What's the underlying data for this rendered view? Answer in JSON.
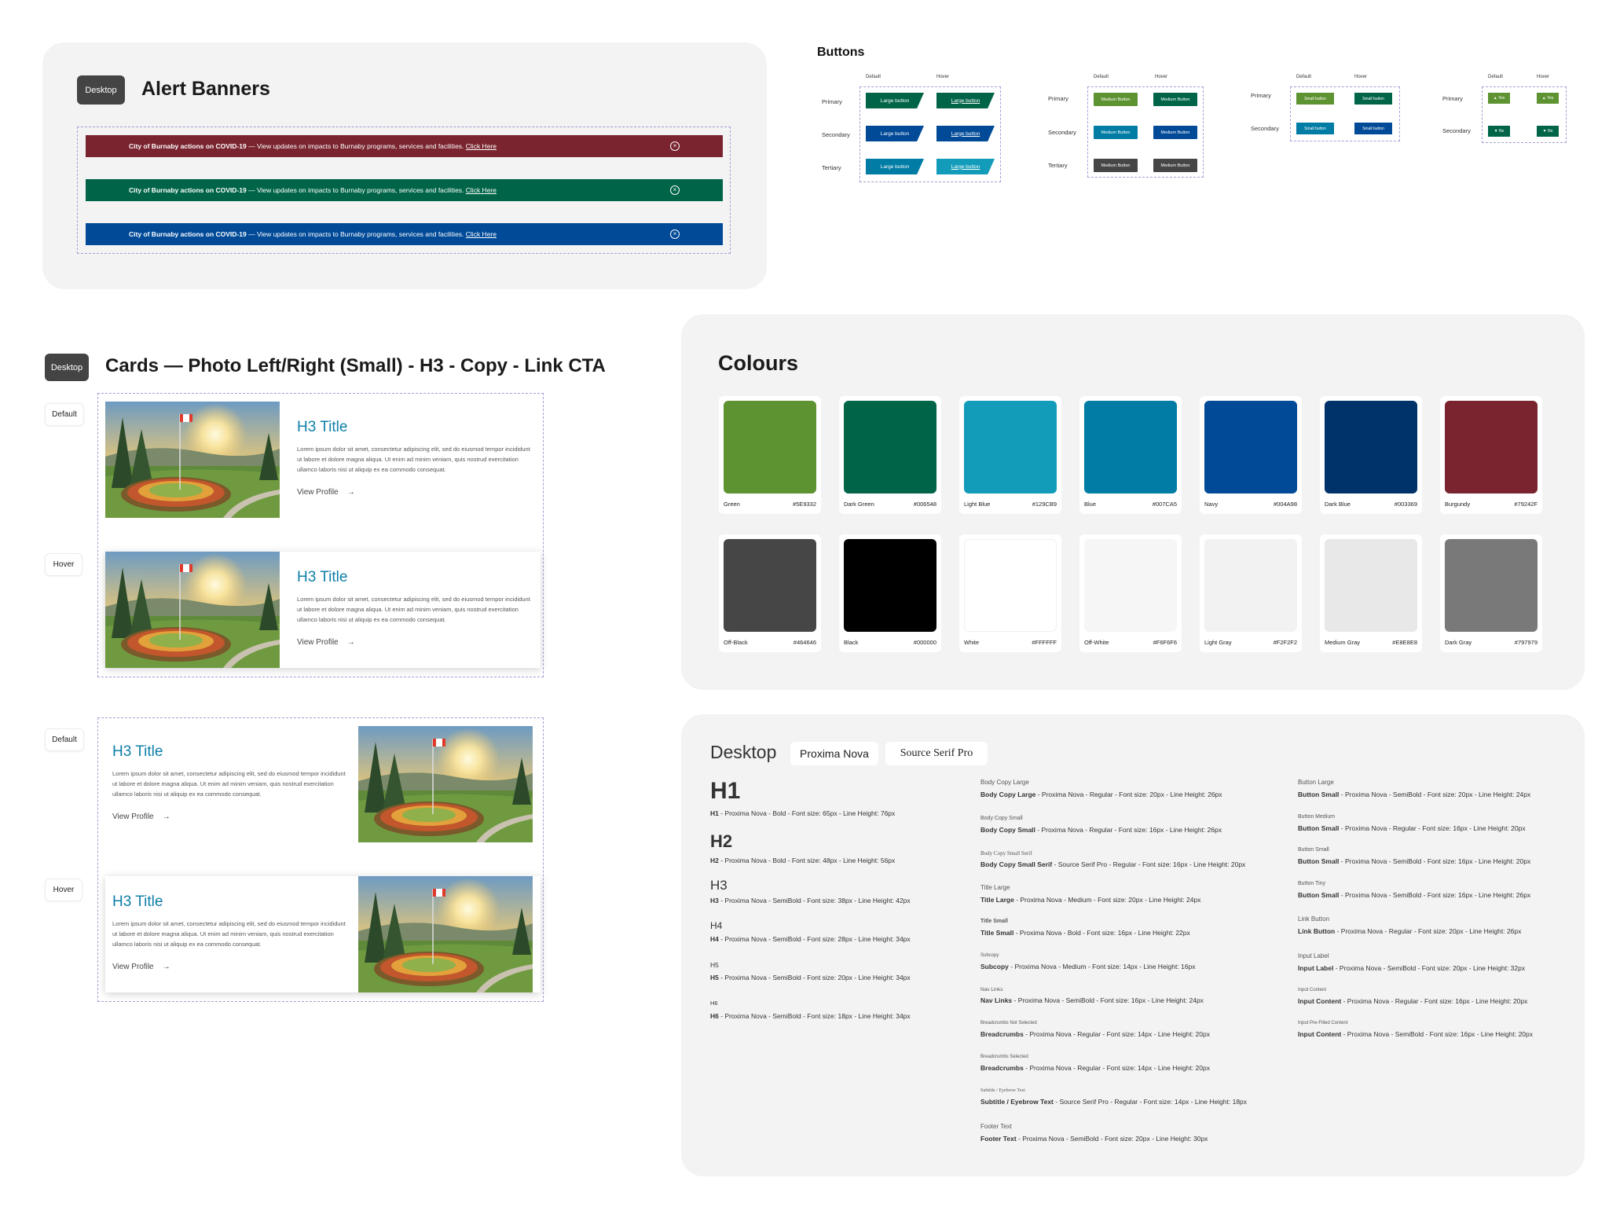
{
  "alerts": {
    "tag": "Desktop",
    "title": "Alert Banners",
    "banners": [
      {
        "bold": "City of Burnaby actions on COVID-19",
        "text": " — View updates on impacts to Burnaby programs, services and facilities. ",
        "link": "Click Here",
        "color": "#79242F"
      },
      {
        "bold": "City of Burnaby actions on COVID-19",
        "text": " — View updates on impacts to Burnaby programs, services and facilities. ",
        "link": "Click Here",
        "color": "#006548"
      },
      {
        "bold": "City of Burnaby actions on COVID-19",
        "text": " — View updates on impacts to Burnaby programs, services and facilities. ",
        "link": "Click Here",
        "color": "#004A98"
      }
    ]
  },
  "buttons": {
    "title": "Buttons",
    "default_label": "Default",
    "hover_label": "Hover",
    "row_primary": "Primary",
    "row_secondary": "Secondary",
    "row_tertiary": "Tertiary",
    "large_label": "Large button",
    "medium_label": "Medium Button",
    "small_label": "Small button",
    "yes_label": "Yes",
    "no_label": "No"
  },
  "cards": {
    "tag": "Desktop",
    "title": "Cards — Photo Left/Right (Small) - H3 - Copy - Link CTA",
    "state_default": "Default",
    "state_hover": "Hover",
    "card_title": "H3 Title",
    "card_copy": "Lorem ipsum dolor sit amet, consectetur adipiscing elit, sed do eiusmod tempor incididunt ut labore et dolore magna aliqua. Ut enim ad minim veniam, quis nostrud exercitation ullamco laboris nisi ut aliquip ex ea commodo consequat.",
    "card_link": "View Profile",
    "arrow": "→"
  },
  "colours": {
    "title": "Colours",
    "swatches": [
      {
        "name": "Green",
        "hex": "#5E9332"
      },
      {
        "name": "Dark Green",
        "hex": "#006548"
      },
      {
        "name": "Light Blue",
        "hex": "#129CB9"
      },
      {
        "name": "Blue",
        "hex": "#007CA5"
      },
      {
        "name": "Navy",
        "hex": "#004A98"
      },
      {
        "name": "Dark Blue",
        "hex": "#003369"
      },
      {
        "name": "Burgundy",
        "hex": "#79242F"
      },
      {
        "name": "Off-Black",
        "hex": "#464646"
      },
      {
        "name": "Black",
        "hex": "#000000"
      },
      {
        "name": "White",
        "hex": "#FFFFFF"
      },
      {
        "name": "Off-White",
        "hex": "#F6F6F6"
      },
      {
        "name": "Light Gray",
        "hex": "#F2F2F2"
      },
      {
        "name": "Medium Gray",
        "hex": "#E8E8E8"
      },
      {
        "name": "Dark Gray",
        "hex": "#797979"
      }
    ]
  },
  "typography": {
    "title": "Desktop",
    "font1": "Proxima Nova",
    "font2": "Source Serif Pro",
    "headings": [
      {
        "sample": "H1",
        "name": "H1",
        "spec": " - Proxima Nova - Bold - Font size: 65px - Line Height: 76px"
      },
      {
        "sample": "H2",
        "name": "H2",
        "spec": " - Proxima Nova - Bold - Font size: 48px - Line Height: 56px"
      },
      {
        "sample": "H3",
        "name": "H3",
        "spec": " - Proxima Nova - SemiBold - Font size: 38px - Line Height: 42px"
      },
      {
        "sample": "H4",
        "name": "H4",
        "spec": " - Proxima Nova - SemiBold - Font size: 28px - Line Height: 34px"
      },
      {
        "sample": "H5",
        "name": "H5",
        "spec": " - Proxima Nova - SemiBold - Font size: 20px - Line Height: 34px"
      },
      {
        "sample": "H6",
        "name": "H6",
        "spec": " - Proxima Nova - SemiBold - Font size: 18px - Line Height: 34px"
      }
    ],
    "body": [
      {
        "cap": "Body Copy Large",
        "name": "Body Copy Large",
        "spec": " - Proxima Nova - Regular - Font size: 20px - Line Height: 26px"
      },
      {
        "cap": "Body Copy Small",
        "name": "Body Copy Small",
        "spec": " - Proxima Nova - Regular - Font size: 16px - Line Height: 26px"
      },
      {
        "cap": "Body Copy Small Serif",
        "name": "Body Copy Small Serif",
        "spec": " - Source Serif Pro - Regular - Font size: 16px - Line Height: 20px"
      },
      {
        "cap": "Title Large",
        "name": "Title Large",
        "spec": " - Proxima Nova - Medium - Font size: 20px - Line Height: 24px"
      },
      {
        "cap": "Title Small",
        "name": "Title Small",
        "spec": " - Proxima Nova - Bold - Font size: 16px - Line Height: 22px"
      },
      {
        "cap": "Subcopy",
        "name": "Subcopy",
        "spec": " - Proxima Nova - Medium - Font size: 14px - Line Height: 16px"
      },
      {
        "cap": "Nav Links",
        "name": "Nav Links",
        "spec": " - Proxima Nova - SemiBold - Font size: 16px - Line Height: 24px"
      },
      {
        "cap": "Breadcrumbs Not Selected",
        "name": "Breadcrumbs",
        "spec": " - Proxima Nova - Regular - Font size: 14px - Line Height: 20px"
      },
      {
        "cap": "Breadcrumbs Selected",
        "name": "Breadcrumbs",
        "spec": " - Proxima Nova - Regular - Font size: 14px - Line Height: 20px"
      },
      {
        "cap": "Subtitle / Eyebrow Text",
        "name": "Subtitle / Eyebrow Text",
        "spec": " - Source Serif Pro - Regular - Font size: 14px - Line Height: 18px"
      },
      {
        "cap": "Footer Text",
        "name": "Footer Text",
        "spec": " - Proxima Nova - SemiBold - Font size: 20px - Line Height: 30px"
      }
    ],
    "ui": [
      {
        "cap": "Button Large",
        "name": "Button Small",
        "spec": " - Proxima Nova - SemiBold - Font size: 20px - Line Height: 24px"
      },
      {
        "cap": "Button Medium",
        "name": "Button Small",
        "spec": " - Proxima Nova - Regular - Font size: 16px - Line Height: 20px"
      },
      {
        "cap": "Button Small",
        "name": "Button Small",
        "spec": " - Proxima Nova - SemiBold - Font size: 16px - Line Height: 20px"
      },
      {
        "cap": "Button Tiny",
        "name": "Button Small",
        "spec": " - Proxima Nova - SemiBold - Font size: 16px - Line Height: 26px"
      },
      {
        "cap": "Link Button",
        "name": "Link Button",
        "spec": " - Proxima Nova - Regular - Font size: 20px - Line Height: 26px"
      },
      {
        "cap": "Input Label",
        "name": "Input Label",
        "spec": " - Proxima Nova - SemiBold - Font size: 20px - Line Height: 32px"
      },
      {
        "cap": "Input Content",
        "name": "Input Content",
        "spec": " - Proxima Nova - Regular - Font size: 16px - Line Height: 20px"
      },
      {
        "cap": "Input Pre-Filled Content",
        "name": "Input Content",
        "spec": " - Proxima Nova - SemiBold - Font size: 16px - Line Height: 20px"
      }
    ]
  }
}
